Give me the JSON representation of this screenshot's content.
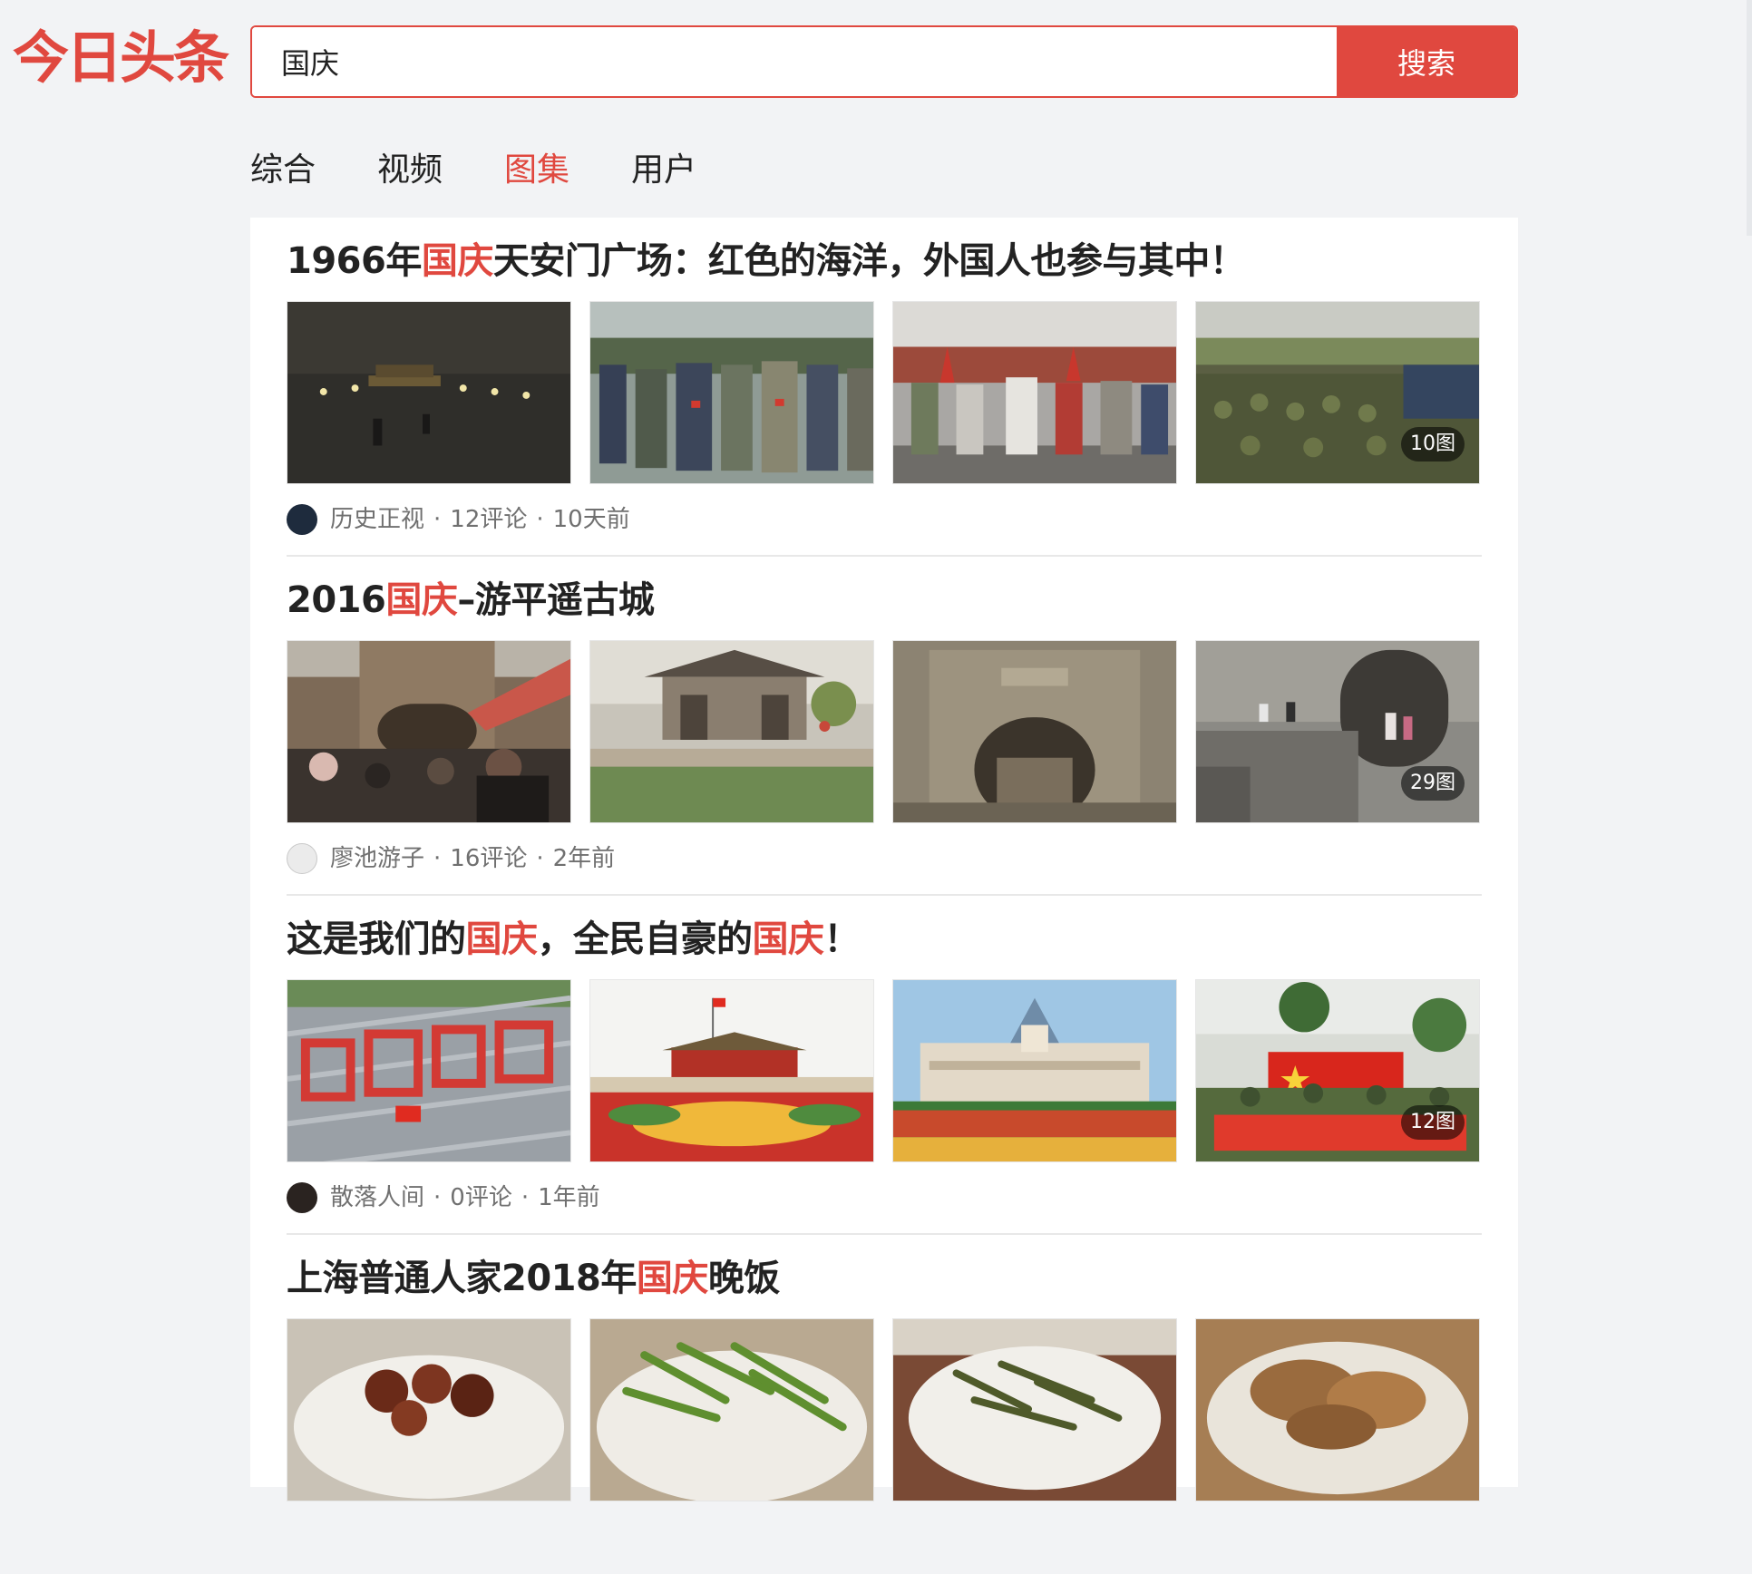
{
  "header": {
    "logo_text": "今日头条",
    "search": {
      "value": "国庆",
      "button_label": "搜索"
    }
  },
  "tabs": [
    {
      "label": "综合",
      "active": false
    },
    {
      "label": "视频",
      "active": false
    },
    {
      "label": "图集",
      "active": true
    },
    {
      "label": "用户",
      "active": false
    }
  ],
  "results": [
    {
      "title_parts": [
        {
          "text": "1966年",
          "highlight": false
        },
        {
          "text": "国庆",
          "highlight": true
        },
        {
          "text": "天安门广场：红色的海洋，外国人也参与其中！",
          "highlight": false
        }
      ],
      "image_count": "10图",
      "author": "历史正视",
      "comments": "12评论",
      "time": "10天前",
      "sep": "·"
    },
    {
      "title_parts": [
        {
          "text": "2016",
          "highlight": false
        },
        {
          "text": "国庆",
          "highlight": true
        },
        {
          "text": "–游平遥古城",
          "highlight": false
        }
      ],
      "image_count": "29图",
      "author": "廖池游子",
      "comments": "16评论",
      "time": "2年前",
      "sep": "·"
    },
    {
      "title_parts": [
        {
          "text": "这是我们的",
          "highlight": false
        },
        {
          "text": "国庆",
          "highlight": true
        },
        {
          "text": "，全民自豪的",
          "highlight": false
        },
        {
          "text": "国庆",
          "highlight": true
        },
        {
          "text": "！",
          "highlight": false
        }
      ],
      "image_count": "12图",
      "author": "散落人间",
      "comments": "0评论",
      "time": "1年前",
      "sep": "·"
    },
    {
      "title_parts": [
        {
          "text": "上海普通人家2018年",
          "highlight": false
        },
        {
          "text": "国庆",
          "highlight": true
        },
        {
          "text": "晚饭",
          "highlight": false
        }
      ]
    }
  ],
  "colors": {
    "accent": "#e0483f",
    "page_bg": "#f2f3f5",
    "card_bg": "#ffffff",
    "meta_text": "#707070"
  }
}
